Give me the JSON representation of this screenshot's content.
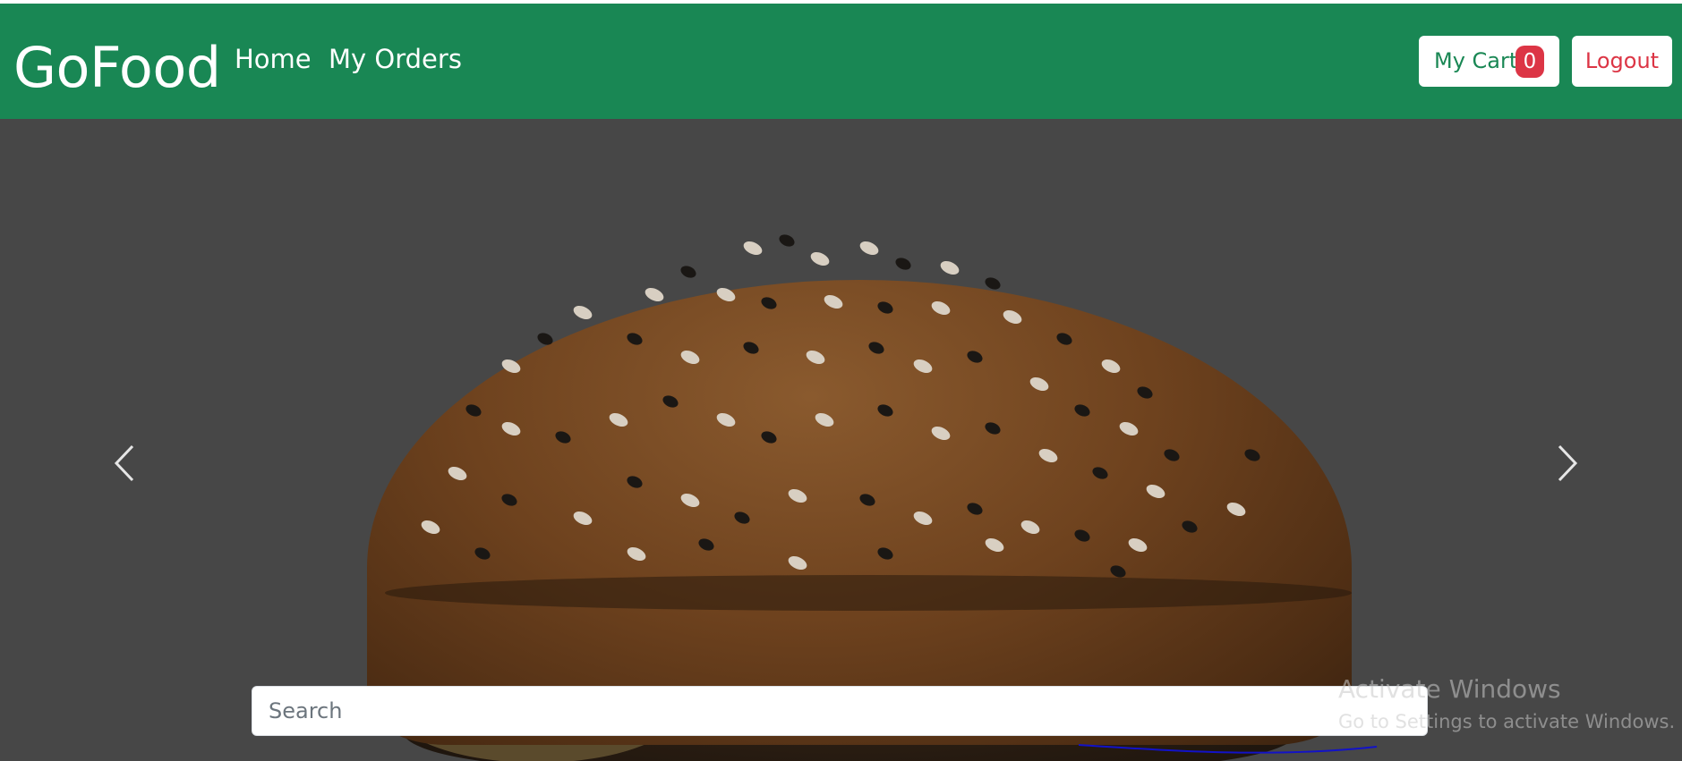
{
  "navbar": {
    "brand": "GoFood",
    "links": [
      {
        "label": "Home"
      },
      {
        "label": "My Orders"
      }
    ],
    "cart_label": "My Cart",
    "cart_count": "0",
    "logout_label": "Logout",
    "background_color": "#198754"
  },
  "carousel": {
    "prev_icon": "chevron-left-icon",
    "next_icon": "chevron-right-icon",
    "image": "burger"
  },
  "search": {
    "placeholder": "Search",
    "value": ""
  },
  "watermark": {
    "title": "Activate Windows",
    "subtitle": "Go to Settings to activate Windows."
  },
  "colors": {
    "accent": "#198754",
    "danger": "#dc3545"
  }
}
